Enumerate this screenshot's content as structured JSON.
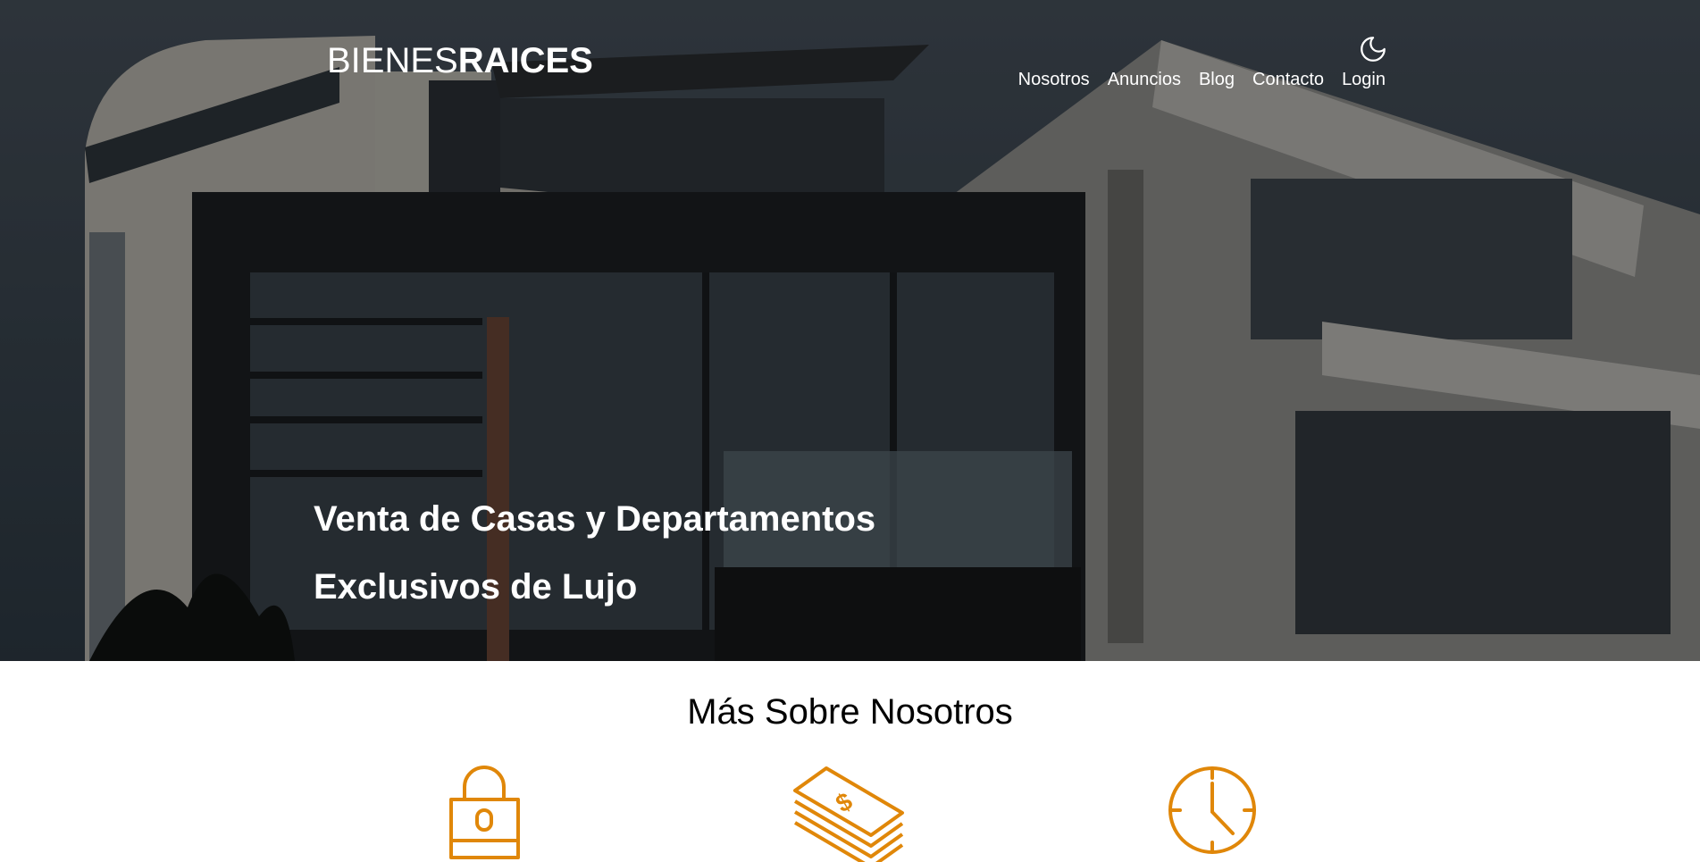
{
  "header": {
    "logo_light": "BIENES",
    "logo_bold": "RAICES",
    "nav": [
      "Nosotros",
      "Anuncios",
      "Blog",
      "Contacto",
      "Login"
    ],
    "dark_mode_icon": "moon-icon"
  },
  "hero": {
    "title_line1": "Venta de Casas y Departamentos",
    "title_line2": "Exclusivos de Lujo"
  },
  "about": {
    "title": "Más Sobre Nosotros",
    "icons": [
      "lock-icon",
      "money-icon",
      "clock-icon"
    ]
  },
  "colors": {
    "accent": "#E08709",
    "hero_text": "#FFFFFF",
    "body_text": "#000000"
  }
}
